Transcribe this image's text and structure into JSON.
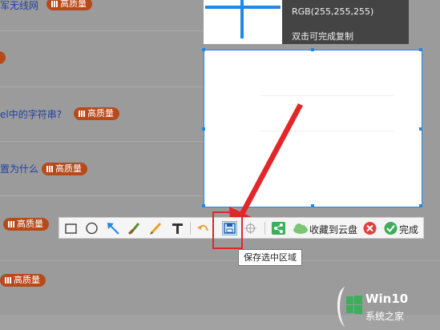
{
  "rows": [
    {
      "text": "军无线网",
      "badge": "高质量"
    },
    {
      "text": "",
      "badge": ""
    },
    {
      "text": "el中的字符串?",
      "badge": "高质量"
    },
    {
      "text": "置为什么",
      "badge": "高质量"
    },
    {
      "text": "",
      "badge": "高质量"
    },
    {
      "text": "",
      "badge": "高质量"
    }
  ],
  "magnifier": {
    "rgb": "RGB(255,255,255)",
    "hint": "双击可完成复制"
  },
  "toolbar": {
    "tools": [
      "rectangle-icon",
      "ellipse-icon",
      "arrow-icon",
      "brush-icon",
      "pencil-icon",
      "text-icon",
      "undo-icon",
      "save-icon",
      "pin-icon",
      "share-icon",
      "cloud-icon",
      "cancel-icon",
      "check-icon"
    ],
    "cloud_label": "收藏到云盘",
    "done_label": "完成"
  },
  "tooltip": "保存选中区域",
  "watermark": {
    "brand": "Win10",
    "site": "系统之家"
  },
  "colors": {
    "accent": "#1e88e5",
    "badge": "#b84a1a",
    "highlight": "#e2262a"
  }
}
